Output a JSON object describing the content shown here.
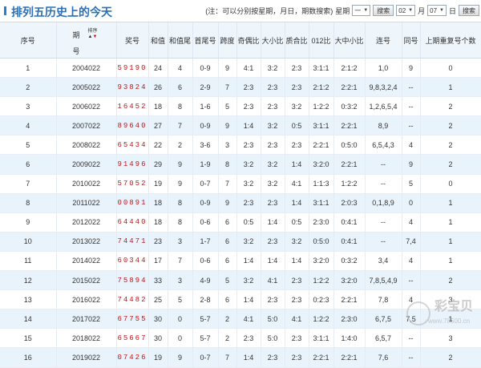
{
  "page": {
    "title": "排列五历史上的今天",
    "note": "(注：可以分别按星期，月日，期数搜索)",
    "weekday_label": "星期",
    "weekday_value": "一",
    "search_label": "搜索",
    "month_value": "02",
    "month_label": "月",
    "day_value": "07",
    "day_label": "日",
    "search2_label": "搜索"
  },
  "headers": {
    "seq": "序号",
    "period_top": "期",
    "period_bottom": "号",
    "sort": "排序",
    "number": "奖号",
    "sum": "和值",
    "sum_tail": "和值尾",
    "first_tail": "首尾号",
    "span": "跨度",
    "odd_even": "奇偶比",
    "big_small": "大小比",
    "prime_comp": "质合比",
    "route012": "012比",
    "big_mid_small": "大中小比",
    "repeat": "连号",
    "same": "同号",
    "prev_repeat": "上期重复号个数"
  },
  "rows": [
    {
      "seq": "1",
      "period": "2004022",
      "number": "59190",
      "sum": "24",
      "sum_tail": "4",
      "first_tail": "0-9",
      "span": "9",
      "odd_even": "4:1",
      "big_small": "3:2",
      "prime_comp": "2:3",
      "route012": "3:1:1",
      "bms": "2:1:2",
      "repeat": "1,0",
      "same": "9",
      "prev": "0"
    },
    {
      "seq": "2",
      "period": "2005022",
      "number": "93824",
      "sum": "26",
      "sum_tail": "6",
      "first_tail": "2-9",
      "span": "7",
      "odd_even": "2:3",
      "big_small": "2:3",
      "prime_comp": "2:3",
      "route012": "2:1:2",
      "bms": "2:2:1",
      "repeat": "9,8,3,2,4",
      "same": "--",
      "prev": "1"
    },
    {
      "seq": "3",
      "period": "2006022",
      "number": "16452",
      "sum": "18",
      "sum_tail": "8",
      "first_tail": "1-6",
      "span": "5",
      "odd_even": "2:3",
      "big_small": "2:3",
      "prime_comp": "3:2",
      "route012": "1:2:2",
      "bms": "0:3:2",
      "repeat": "1,2,6,5,4",
      "same": "--",
      "prev": "2"
    },
    {
      "seq": "4",
      "period": "2007022",
      "number": "89640",
      "sum": "27",
      "sum_tail": "7",
      "first_tail": "0-9",
      "span": "9",
      "odd_even": "1:4",
      "big_small": "3:2",
      "prime_comp": "0:5",
      "route012": "3:1:1",
      "bms": "2:2:1",
      "repeat": "8,9",
      "same": "--",
      "prev": "2"
    },
    {
      "seq": "5",
      "period": "2008022",
      "number": "65434",
      "sum": "22",
      "sum_tail": "2",
      "first_tail": "3-6",
      "span": "3",
      "odd_even": "2:3",
      "big_small": "2:3",
      "prime_comp": "2:3",
      "route012": "2:2:1",
      "bms": "0:5:0",
      "repeat": "6,5,4,3",
      "same": "4",
      "prev": "2"
    },
    {
      "seq": "6",
      "period": "2009022",
      "number": "91496",
      "sum": "29",
      "sum_tail": "9",
      "first_tail": "1-9",
      "span": "8",
      "odd_even": "3:2",
      "big_small": "3:2",
      "prime_comp": "1:4",
      "route012": "3:2:0",
      "bms": "2:2:1",
      "repeat": "--",
      "same": "9",
      "prev": "2"
    },
    {
      "seq": "7",
      "period": "2010022",
      "number": "57052",
      "sum": "19",
      "sum_tail": "9",
      "first_tail": "0-7",
      "span": "7",
      "odd_even": "3:2",
      "big_small": "3:2",
      "prime_comp": "4:1",
      "route012": "1:1:3",
      "bms": "1:2:2",
      "repeat": "--",
      "same": "5",
      "prev": "0"
    },
    {
      "seq": "8",
      "period": "2011022",
      "number": "00891",
      "sum": "18",
      "sum_tail": "8",
      "first_tail": "0-9",
      "span": "9",
      "odd_even": "2:3",
      "big_small": "2:3",
      "prime_comp": "1:4",
      "route012": "3:1:1",
      "bms": "2:0:3",
      "repeat": "0,1,8,9",
      "same": "0",
      "prev": "1"
    },
    {
      "seq": "9",
      "period": "2012022",
      "number": "64440",
      "sum": "18",
      "sum_tail": "8",
      "first_tail": "0-6",
      "span": "6",
      "odd_even": "0:5",
      "big_small": "1:4",
      "prime_comp": "0:5",
      "route012": "2:3:0",
      "bms": "0:4:1",
      "repeat": "--",
      "same": "4",
      "prev": "1"
    },
    {
      "seq": "10",
      "period": "2013022",
      "number": "74471",
      "sum": "23",
      "sum_tail": "3",
      "first_tail": "1-7",
      "span": "6",
      "odd_even": "3:2",
      "big_small": "2:3",
      "prime_comp": "3:2",
      "route012": "0:5:0",
      "bms": "0:4:1",
      "repeat": "--",
      "same": "7,4",
      "prev": "1"
    },
    {
      "seq": "11",
      "period": "2014022",
      "number": "60344",
      "sum": "17",
      "sum_tail": "7",
      "first_tail": "0-6",
      "span": "6",
      "odd_even": "1:4",
      "big_small": "1:4",
      "prime_comp": "1:4",
      "route012": "3:2:0",
      "bms": "0:3:2",
      "repeat": "3,4",
      "same": "4",
      "prev": "1"
    },
    {
      "seq": "12",
      "period": "2015022",
      "number": "75894",
      "sum": "33",
      "sum_tail": "3",
      "first_tail": "4-9",
      "span": "5",
      "odd_even": "3:2",
      "big_small": "4:1",
      "prime_comp": "2:3",
      "route012": "1:2:2",
      "bms": "3:2:0",
      "repeat": "7,8,5,4,9",
      "same": "--",
      "prev": "2"
    },
    {
      "seq": "13",
      "period": "2016022",
      "number": "74482",
      "sum": "25",
      "sum_tail": "5",
      "first_tail": "2-8",
      "span": "6",
      "odd_even": "1:4",
      "big_small": "2:3",
      "prime_comp": "2:3",
      "route012": "0:2:3",
      "bms": "2:2:1",
      "repeat": "7,8",
      "same": "4",
      "prev": "3"
    },
    {
      "seq": "14",
      "period": "2017022",
      "number": "67755",
      "sum": "30",
      "sum_tail": "0",
      "first_tail": "5-7",
      "span": "2",
      "odd_even": "4:1",
      "big_small": "5:0",
      "prime_comp": "4:1",
      "route012": "1:2:2",
      "bms": "2:3:0",
      "repeat": "6,7,5",
      "same": "7,5",
      "prev": "1"
    },
    {
      "seq": "15",
      "period": "2018022",
      "number": "65667",
      "sum": "30",
      "sum_tail": "0",
      "first_tail": "5-7",
      "span": "2",
      "odd_even": "2:3",
      "big_small": "5:0",
      "prime_comp": "2:3",
      "route012": "3:1:1",
      "bms": "1:4:0",
      "repeat": "6,5,7",
      "same": "--",
      "prev": "3"
    },
    {
      "seq": "16",
      "period": "2019022",
      "number": "07426",
      "sum": "19",
      "sum_tail": "9",
      "first_tail": "0-7",
      "span": "7",
      "odd_even": "1:4",
      "big_small": "2:3",
      "prime_comp": "2:3",
      "route012": "2:2:1",
      "bms": "2:2:1",
      "repeat": "7,6",
      "same": "--",
      "prev": "2"
    }
  ],
  "watermark": {
    "text": "彩宝贝",
    "url": "www.78500.cn"
  }
}
